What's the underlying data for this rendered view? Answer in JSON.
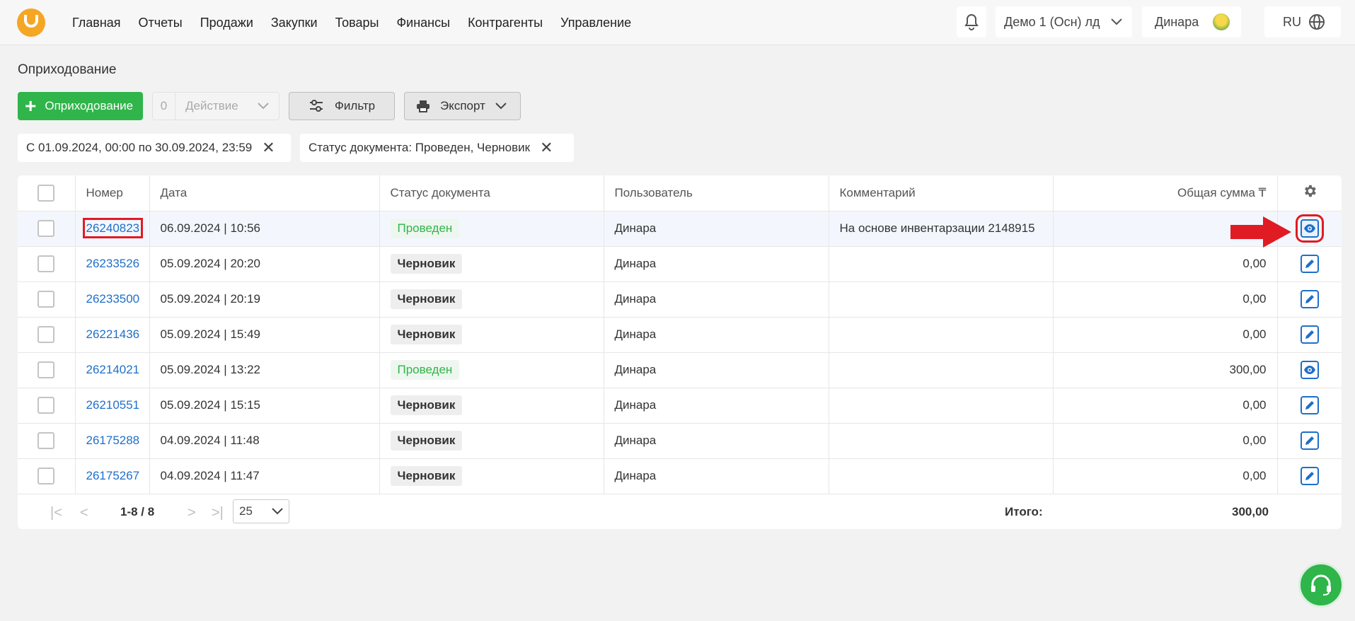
{
  "nav": {
    "items": [
      "Главная",
      "Отчеты",
      "Продажи",
      "Закупки",
      "Товары",
      "Финансы",
      "Контрагенты",
      "Управление"
    ],
    "org": "Демо 1 (Осн) лд",
    "user": "Динара",
    "lang": "RU"
  },
  "page": {
    "title": "Оприходование",
    "add_label": "Оприходование",
    "action_count": "0",
    "action_label": "Действие",
    "filter_label": "Фильтр",
    "export_label": "Экспорт"
  },
  "filters": {
    "date": "С 01.09.2024, 00:00 по 30.09.2024, 23:59",
    "status": "Статус документа: Проведен, Черновик"
  },
  "table": {
    "headers": {
      "number": "Номер",
      "date": "Дата",
      "status": "Статус документа",
      "user": "Пользователь",
      "comment": "Комментарий",
      "sum": "Общая сумма ₸"
    },
    "rows": [
      {
        "number": "26240823",
        "date": "06.09.2024 | 10:56",
        "status": "Проведен",
        "user": "Динара",
        "comment": "На основе инвентарзации 2148915",
        "sum": ""
      },
      {
        "number": "26233526",
        "date": "05.09.2024 | 20:20",
        "status": "Черновик",
        "user": "Динара",
        "comment": "",
        "sum": "0,00"
      },
      {
        "number": "26233500",
        "date": "05.09.2024 | 20:19",
        "status": "Черновик",
        "user": "Динара",
        "comment": "",
        "sum": "0,00"
      },
      {
        "number": "26221436",
        "date": "05.09.2024 | 15:49",
        "status": "Черновик",
        "user": "Динара",
        "comment": "",
        "sum": "0,00"
      },
      {
        "number": "26214021",
        "date": "05.09.2024 | 13:22",
        "status": "Проведен",
        "user": "Динара",
        "comment": "",
        "sum": "300,00"
      },
      {
        "number": "26210551",
        "date": "05.09.2024 | 15:15",
        "status": "Черновик",
        "user": "Динара",
        "comment": "",
        "sum": "0,00"
      },
      {
        "number": "26175288",
        "date": "04.09.2024 | 11:48",
        "status": "Черновик",
        "user": "Динара",
        "comment": "",
        "sum": "0,00"
      },
      {
        "number": "26175267",
        "date": "04.09.2024 | 11:47",
        "status": "Черновик",
        "user": "Динара",
        "comment": "",
        "sum": "0,00"
      }
    ]
  },
  "pager": {
    "range": "1-8 / 8",
    "page_size": "25",
    "total_label": "Итого:",
    "total_value": "300,00"
  },
  "colors": {
    "accent_green": "#2fb54a",
    "link_blue": "#1f6fc9",
    "highlight_red": "#e01b24"
  }
}
